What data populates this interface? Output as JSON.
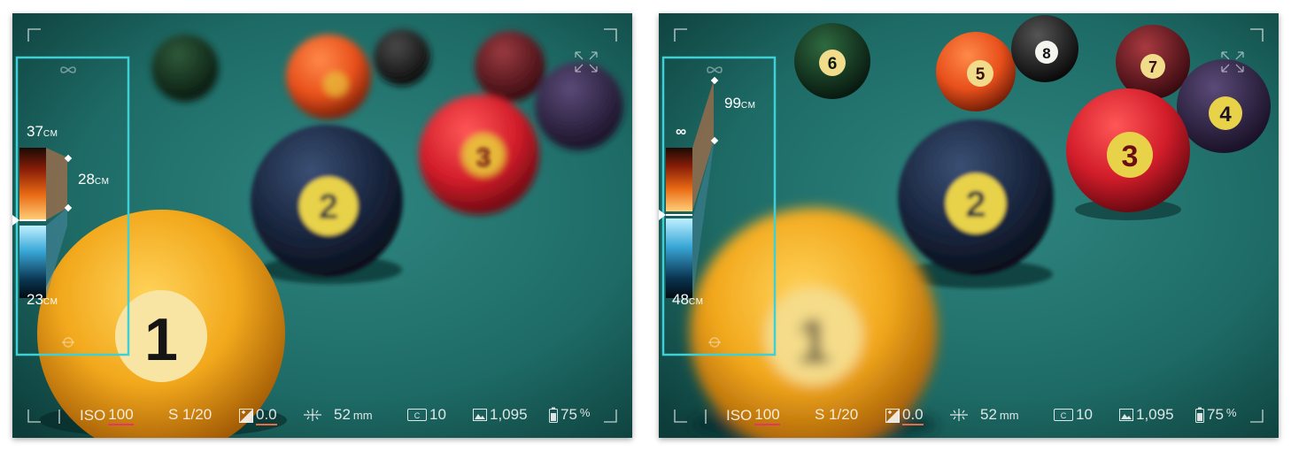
{
  "screens": [
    {
      "focus": {
        "infinity_icon": "infinity-icon",
        "near_value": "37",
        "near_unit": "CM",
        "current_value": "28",
        "current_unit": "CM",
        "far_value": "23",
        "far_unit": "CM",
        "macro_icon": "macro-icon"
      },
      "balls": [
        "1",
        "2",
        "3"
      ],
      "status": {
        "iso_label": "ISO",
        "iso_value": "100",
        "shutter": "S 1/20",
        "exposure": "0.0",
        "focal": "52",
        "focal_unit": "mm",
        "raw_count": "10",
        "photos": "1,095",
        "battery": "75",
        "battery_unit": "%"
      }
    },
    {
      "focus": {
        "infinity_icon": "infinity-icon",
        "near_value": "∞",
        "near_unit": "",
        "current_value": "99",
        "current_unit": "CM",
        "far_value": "48",
        "far_unit": "CM",
        "macro_icon": "macro-icon"
      },
      "balls": [
        "1",
        "2",
        "3",
        "4",
        "5",
        "6",
        "7",
        "8"
      ],
      "status": {
        "iso_label": "ISO",
        "iso_value": "100",
        "shutter": "S 1/20",
        "exposure": "0.0",
        "focal": "52",
        "focal_unit": "mm",
        "raw_count": "10",
        "photos": "1,095",
        "battery": "75",
        "battery_unit": "%"
      }
    }
  ],
  "colors": {
    "felt": "#1f6f6a",
    "focus_box": "#3fd0d6",
    "iso_underline": "#e8346a",
    "exposure_underline": "#ea6b42"
  }
}
